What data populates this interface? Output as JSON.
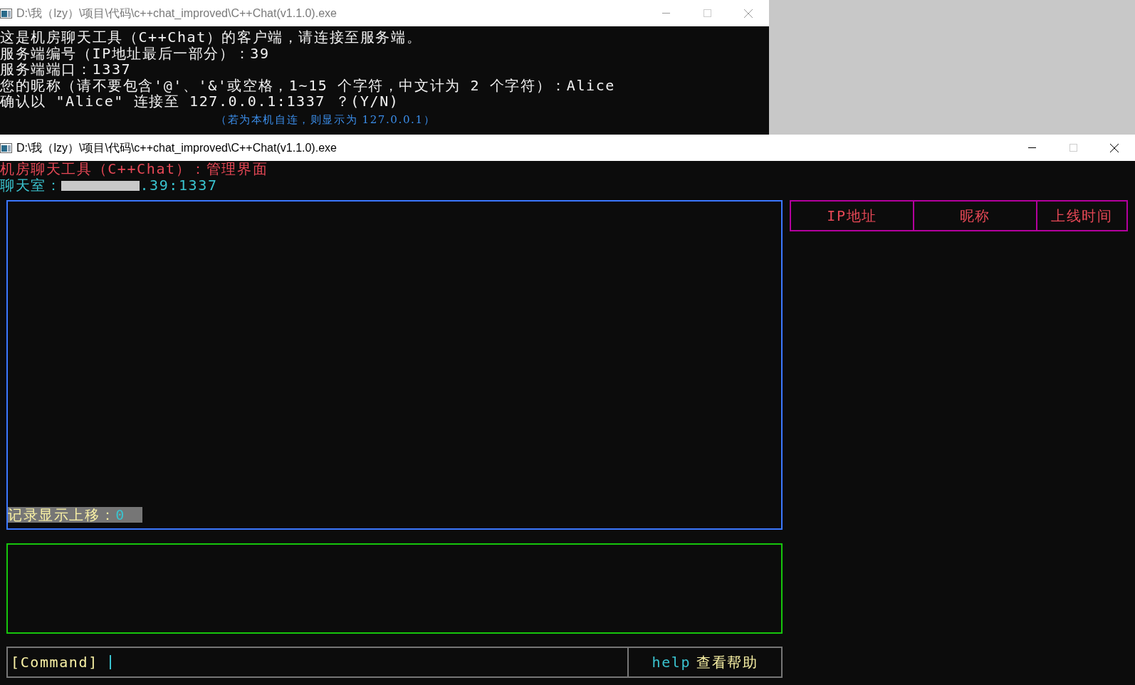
{
  "console_window": {
    "title": "D:\\我（lzy）\\项目\\代码\\c++chat_improved\\C++Chat(v1.1.0).exe",
    "active": false,
    "lines": [
      "这是机房聊天工具（C++Chat）的客户端，请连接至服务端。",
      "服务端编号（IP地址最后一部分）：39",
      "服务端端口：1337",
      "您的昵称（请不要包含'@'、'&'或空格，1~15 个字符，中文计为 2 个字符）：Alice",
      "确认以 \"Alice\" 连接至 127.0.0.1:1337 ？(Y/N)"
    ],
    "note": "（若为本机自连，则显示为 127.0.0.1）"
  },
  "admin_window": {
    "title": "D:\\我（lzy）\\项目\\代码\\c++chat_improved\\C++Chat(v1.1.0).exe",
    "active": true,
    "heading": "机房聊天工具（C++Chat）：管理界面",
    "room_label": "聊天室：",
    "room_address": ".39:1337",
    "scroll_label": "记录显示上移：",
    "scroll_value": "0",
    "user_table": {
      "columns": [
        "IP地址",
        "昵称",
        "上线时间"
      ]
    },
    "command_prompt": "[Command]",
    "hint_command": "help",
    "hint_text": "查看帮助"
  }
}
